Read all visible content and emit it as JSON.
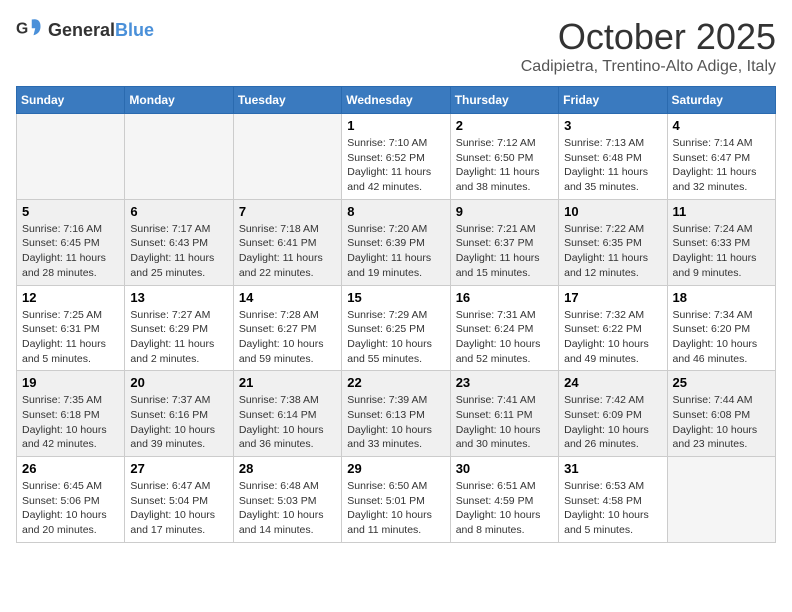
{
  "header": {
    "logo": {
      "general": "General",
      "blue": "Blue"
    },
    "month": "October 2025",
    "location": "Cadipietra, Trentino-Alto Adige, Italy"
  },
  "weekdays": [
    "Sunday",
    "Monday",
    "Tuesday",
    "Wednesday",
    "Thursday",
    "Friday",
    "Saturday"
  ],
  "weeks": [
    [
      {
        "day": "",
        "sunrise": "",
        "sunset": "",
        "daylight": "",
        "empty": true
      },
      {
        "day": "",
        "sunrise": "",
        "sunset": "",
        "daylight": "",
        "empty": true
      },
      {
        "day": "",
        "sunrise": "",
        "sunset": "",
        "daylight": "",
        "empty": true
      },
      {
        "day": "1",
        "sunrise": "Sunrise: 7:10 AM",
        "sunset": "Sunset: 6:52 PM",
        "daylight": "Daylight: 11 hours and 42 minutes.",
        "empty": false
      },
      {
        "day": "2",
        "sunrise": "Sunrise: 7:12 AM",
        "sunset": "Sunset: 6:50 PM",
        "daylight": "Daylight: 11 hours and 38 minutes.",
        "empty": false
      },
      {
        "day": "3",
        "sunrise": "Sunrise: 7:13 AM",
        "sunset": "Sunset: 6:48 PM",
        "daylight": "Daylight: 11 hours and 35 minutes.",
        "empty": false
      },
      {
        "day": "4",
        "sunrise": "Sunrise: 7:14 AM",
        "sunset": "Sunset: 6:47 PM",
        "daylight": "Daylight: 11 hours and 32 minutes.",
        "empty": false
      }
    ],
    [
      {
        "day": "5",
        "sunrise": "Sunrise: 7:16 AM",
        "sunset": "Sunset: 6:45 PM",
        "daylight": "Daylight: 11 hours and 28 minutes.",
        "empty": false
      },
      {
        "day": "6",
        "sunrise": "Sunrise: 7:17 AM",
        "sunset": "Sunset: 6:43 PM",
        "daylight": "Daylight: 11 hours and 25 minutes.",
        "empty": false
      },
      {
        "day": "7",
        "sunrise": "Sunrise: 7:18 AM",
        "sunset": "Sunset: 6:41 PM",
        "daylight": "Daylight: 11 hours and 22 minutes.",
        "empty": false
      },
      {
        "day": "8",
        "sunrise": "Sunrise: 7:20 AM",
        "sunset": "Sunset: 6:39 PM",
        "daylight": "Daylight: 11 hours and 19 minutes.",
        "empty": false
      },
      {
        "day": "9",
        "sunrise": "Sunrise: 7:21 AM",
        "sunset": "Sunset: 6:37 PM",
        "daylight": "Daylight: 11 hours and 15 minutes.",
        "empty": false
      },
      {
        "day": "10",
        "sunrise": "Sunrise: 7:22 AM",
        "sunset": "Sunset: 6:35 PM",
        "daylight": "Daylight: 11 hours and 12 minutes.",
        "empty": false
      },
      {
        "day": "11",
        "sunrise": "Sunrise: 7:24 AM",
        "sunset": "Sunset: 6:33 PM",
        "daylight": "Daylight: 11 hours and 9 minutes.",
        "empty": false
      }
    ],
    [
      {
        "day": "12",
        "sunrise": "Sunrise: 7:25 AM",
        "sunset": "Sunset: 6:31 PM",
        "daylight": "Daylight: 11 hours and 5 minutes.",
        "empty": false
      },
      {
        "day": "13",
        "sunrise": "Sunrise: 7:27 AM",
        "sunset": "Sunset: 6:29 PM",
        "daylight": "Daylight: 11 hours and 2 minutes.",
        "empty": false
      },
      {
        "day": "14",
        "sunrise": "Sunrise: 7:28 AM",
        "sunset": "Sunset: 6:27 PM",
        "daylight": "Daylight: 10 hours and 59 minutes.",
        "empty": false
      },
      {
        "day": "15",
        "sunrise": "Sunrise: 7:29 AM",
        "sunset": "Sunset: 6:25 PM",
        "daylight": "Daylight: 10 hours and 55 minutes.",
        "empty": false
      },
      {
        "day": "16",
        "sunrise": "Sunrise: 7:31 AM",
        "sunset": "Sunset: 6:24 PM",
        "daylight": "Daylight: 10 hours and 52 minutes.",
        "empty": false
      },
      {
        "day": "17",
        "sunrise": "Sunrise: 7:32 AM",
        "sunset": "Sunset: 6:22 PM",
        "daylight": "Daylight: 10 hours and 49 minutes.",
        "empty": false
      },
      {
        "day": "18",
        "sunrise": "Sunrise: 7:34 AM",
        "sunset": "Sunset: 6:20 PM",
        "daylight": "Daylight: 10 hours and 46 minutes.",
        "empty": false
      }
    ],
    [
      {
        "day": "19",
        "sunrise": "Sunrise: 7:35 AM",
        "sunset": "Sunset: 6:18 PM",
        "daylight": "Daylight: 10 hours and 42 minutes.",
        "empty": false
      },
      {
        "day": "20",
        "sunrise": "Sunrise: 7:37 AM",
        "sunset": "Sunset: 6:16 PM",
        "daylight": "Daylight: 10 hours and 39 minutes.",
        "empty": false
      },
      {
        "day": "21",
        "sunrise": "Sunrise: 7:38 AM",
        "sunset": "Sunset: 6:14 PM",
        "daylight": "Daylight: 10 hours and 36 minutes.",
        "empty": false
      },
      {
        "day": "22",
        "sunrise": "Sunrise: 7:39 AM",
        "sunset": "Sunset: 6:13 PM",
        "daylight": "Daylight: 10 hours and 33 minutes.",
        "empty": false
      },
      {
        "day": "23",
        "sunrise": "Sunrise: 7:41 AM",
        "sunset": "Sunset: 6:11 PM",
        "daylight": "Daylight: 10 hours and 30 minutes.",
        "empty": false
      },
      {
        "day": "24",
        "sunrise": "Sunrise: 7:42 AM",
        "sunset": "Sunset: 6:09 PM",
        "daylight": "Daylight: 10 hours and 26 minutes.",
        "empty": false
      },
      {
        "day": "25",
        "sunrise": "Sunrise: 7:44 AM",
        "sunset": "Sunset: 6:08 PM",
        "daylight": "Daylight: 10 hours and 23 minutes.",
        "empty": false
      }
    ],
    [
      {
        "day": "26",
        "sunrise": "Sunrise: 6:45 AM",
        "sunset": "Sunset: 5:06 PM",
        "daylight": "Daylight: 10 hours and 20 minutes.",
        "empty": false
      },
      {
        "day": "27",
        "sunrise": "Sunrise: 6:47 AM",
        "sunset": "Sunset: 5:04 PM",
        "daylight": "Daylight: 10 hours and 17 minutes.",
        "empty": false
      },
      {
        "day": "28",
        "sunrise": "Sunrise: 6:48 AM",
        "sunset": "Sunset: 5:03 PM",
        "daylight": "Daylight: 10 hours and 14 minutes.",
        "empty": false
      },
      {
        "day": "29",
        "sunrise": "Sunrise: 6:50 AM",
        "sunset": "Sunset: 5:01 PM",
        "daylight": "Daylight: 10 hours and 11 minutes.",
        "empty": false
      },
      {
        "day": "30",
        "sunrise": "Sunrise: 6:51 AM",
        "sunset": "Sunset: 4:59 PM",
        "daylight": "Daylight: 10 hours and 8 minutes.",
        "empty": false
      },
      {
        "day": "31",
        "sunrise": "Sunrise: 6:53 AM",
        "sunset": "Sunset: 4:58 PM",
        "daylight": "Daylight: 10 hours and 5 minutes.",
        "empty": false
      },
      {
        "day": "",
        "sunrise": "",
        "sunset": "",
        "daylight": "",
        "empty": true
      }
    ]
  ]
}
